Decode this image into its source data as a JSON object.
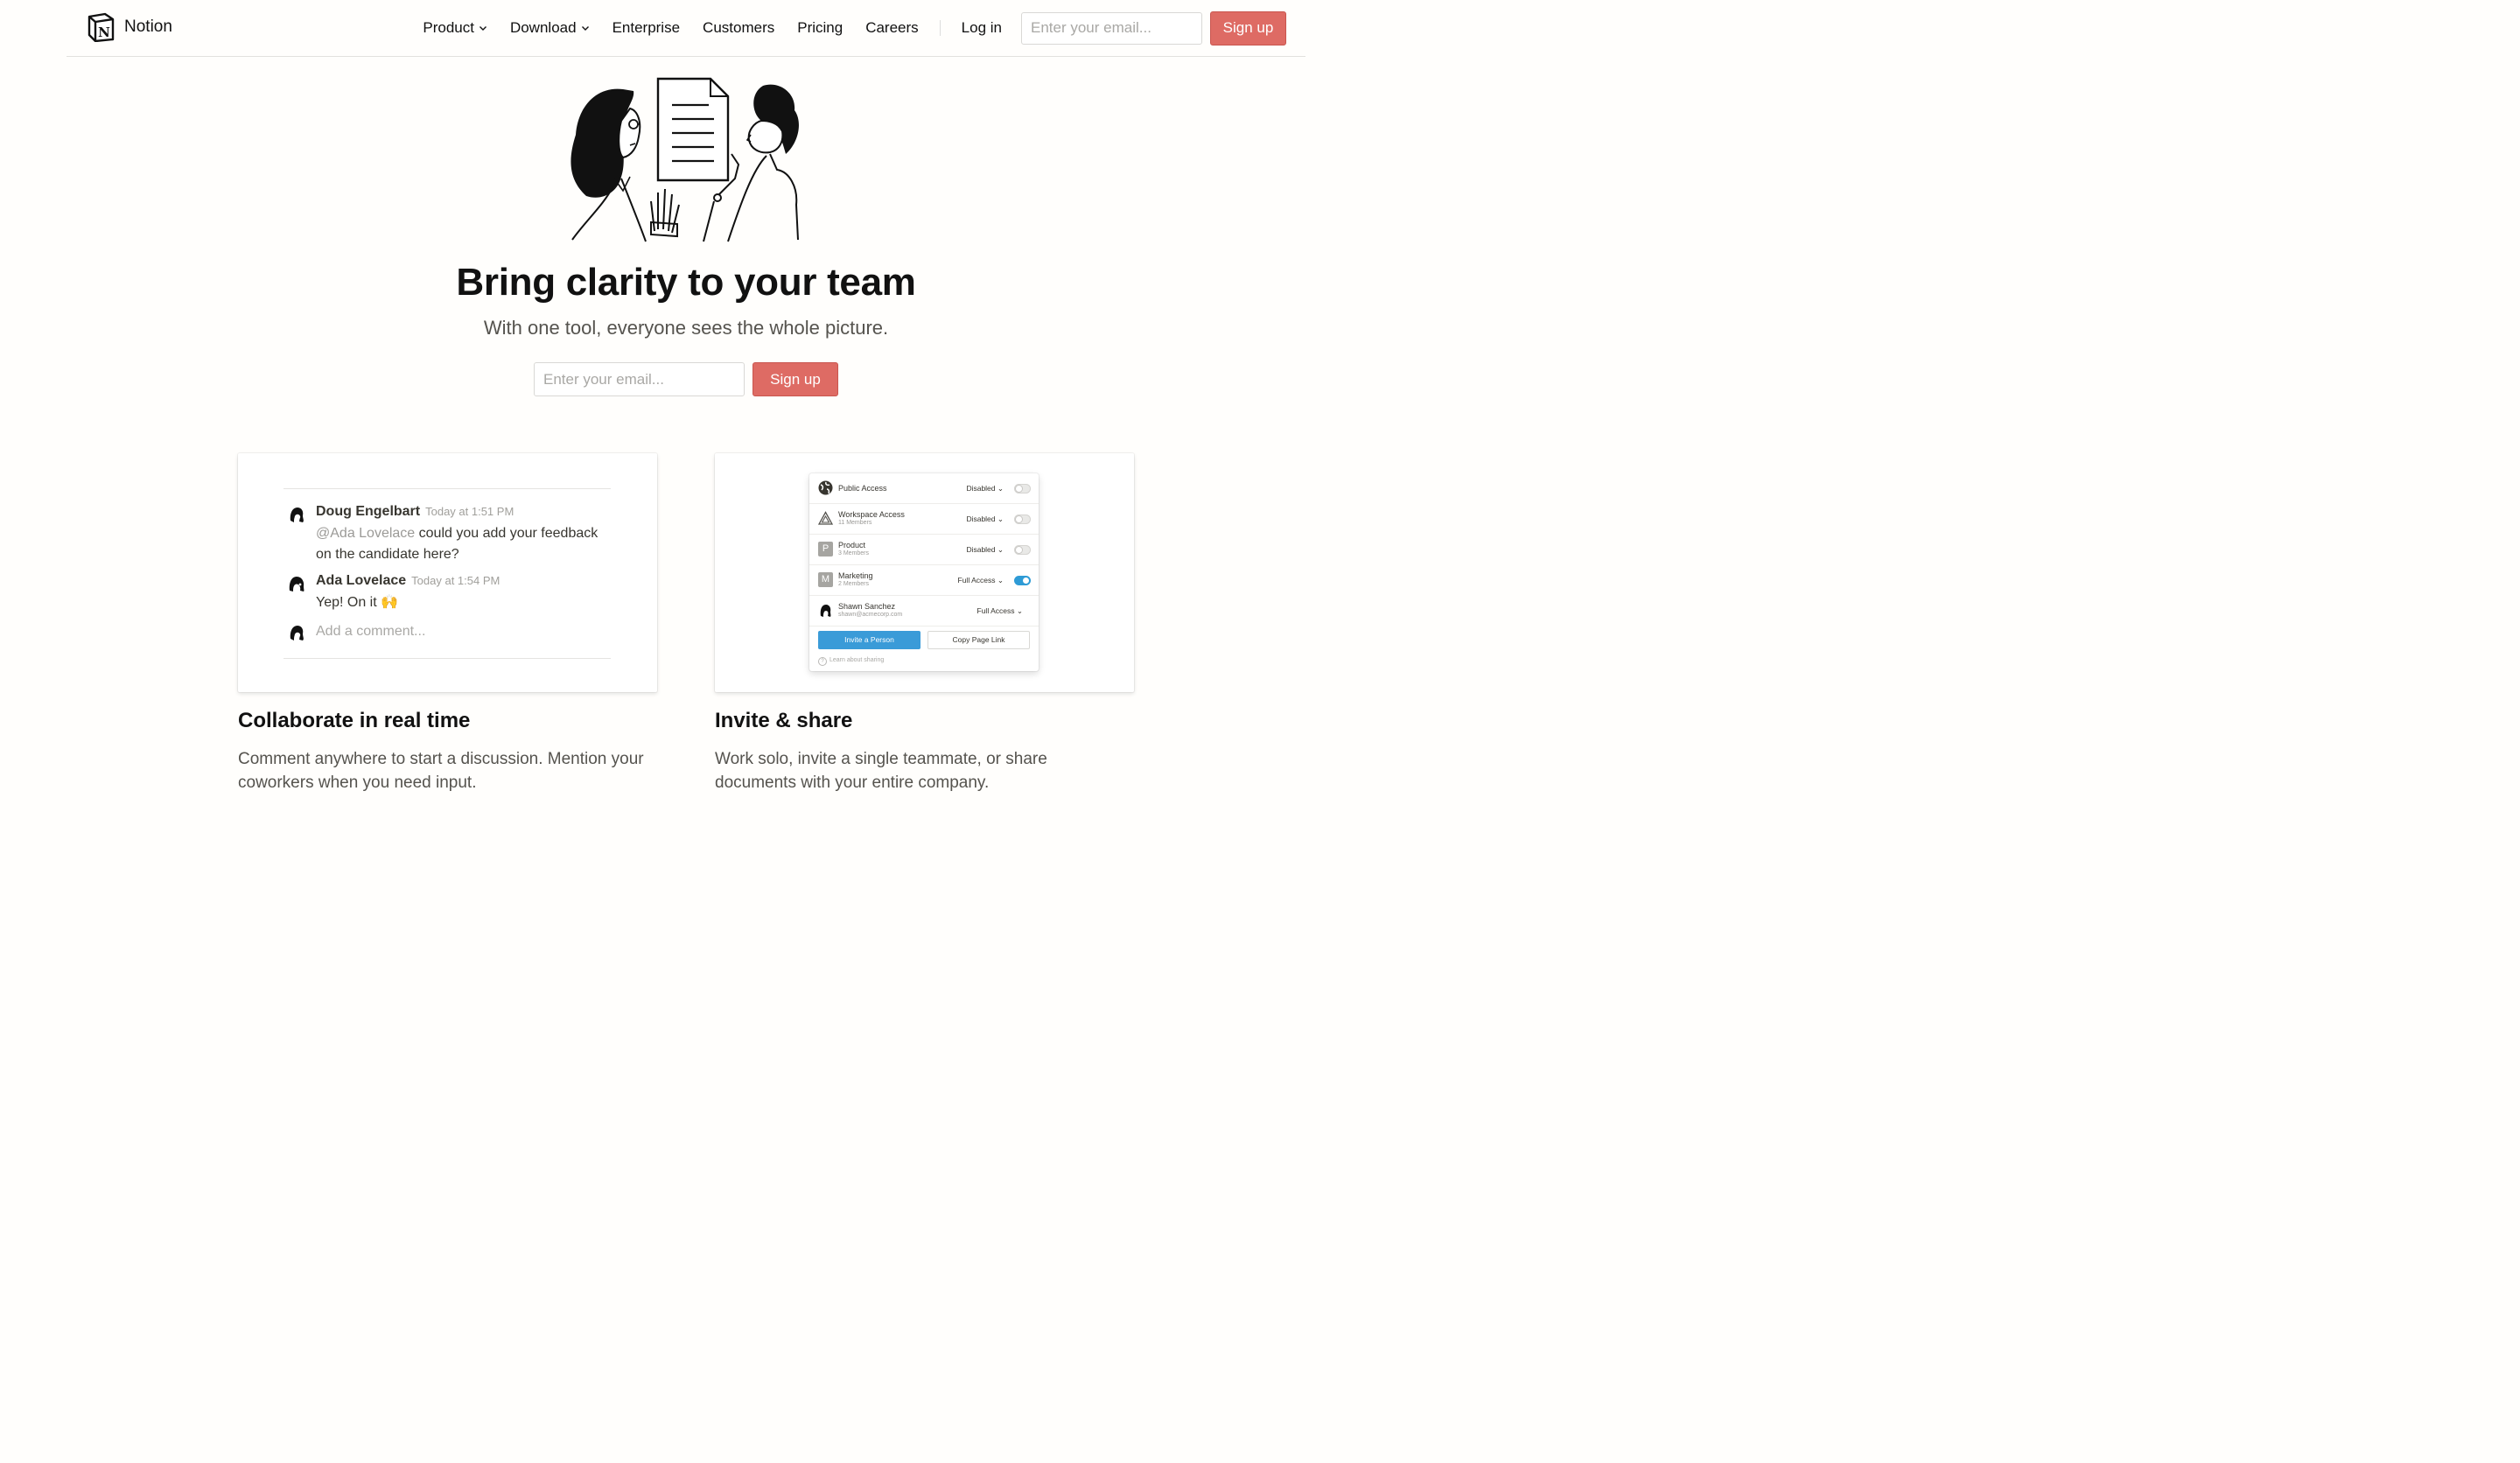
{
  "header": {
    "brand": "Notion",
    "nav": [
      {
        "label": "Product",
        "dropdown": true
      },
      {
        "label": "Download",
        "dropdown": true
      },
      {
        "label": "Enterprise",
        "dropdown": false
      },
      {
        "label": "Customers",
        "dropdown": false
      },
      {
        "label": "Pricing",
        "dropdown": false
      },
      {
        "label": "Careers",
        "dropdown": false
      }
    ],
    "login": "Log in",
    "email_placeholder": "Enter your email...",
    "signup": "Sign up"
  },
  "hero": {
    "title": "Bring clarity to your team",
    "subtitle": "With one tool, everyone sees the whole picture.",
    "email_placeholder": "Enter your email...",
    "signup": "Sign up"
  },
  "comments": {
    "items": [
      {
        "author": "Doug Engelbart",
        "time": "Today at 1:51 PM",
        "mention": "@Ada Lovelace",
        "text": " could you add your feedback on the candidate here?"
      },
      {
        "author": "Ada Lovelace",
        "time": "Today at 1:54 PM",
        "text": "Yep! On it 🙌"
      }
    ],
    "placeholder": "Add a comment..."
  },
  "share": {
    "rows": [
      {
        "name": "Public Access",
        "meta": "",
        "status": "Disabled",
        "toggle": "off",
        "icon": "globe-icon"
      },
      {
        "name": "Workspace Access",
        "meta": "11 Members",
        "status": "Disabled",
        "toggle": "off",
        "icon": "workspace-icon"
      },
      {
        "name": "Product",
        "meta": "3 Members",
        "status": "Disabled",
        "toggle": "off",
        "letter": "P"
      },
      {
        "name": "Marketing",
        "meta": "2 Members",
        "status": "Full Access",
        "toggle": "on",
        "letter": "M"
      },
      {
        "name": "Shawn Sanchez",
        "meta": "shawn@acmecorp.com",
        "status": "Full Access",
        "icon": "person-avatar-icon"
      }
    ],
    "invite": "Invite a Person",
    "copy": "Copy Page Link",
    "learn": "Learn about sharing"
  },
  "features": [
    {
      "title": "Collaborate in real time",
      "desc": "Comment anywhere to start a discussion. Mention your coworkers when you need input."
    },
    {
      "title": "Invite & share",
      "desc": "Work solo, invite a single teammate, or share documents with your entire company."
    }
  ],
  "colors": {
    "accent": "#de6b64",
    "toggle_on": "#2e9bd6",
    "invite_button": "#3a9bd8"
  }
}
